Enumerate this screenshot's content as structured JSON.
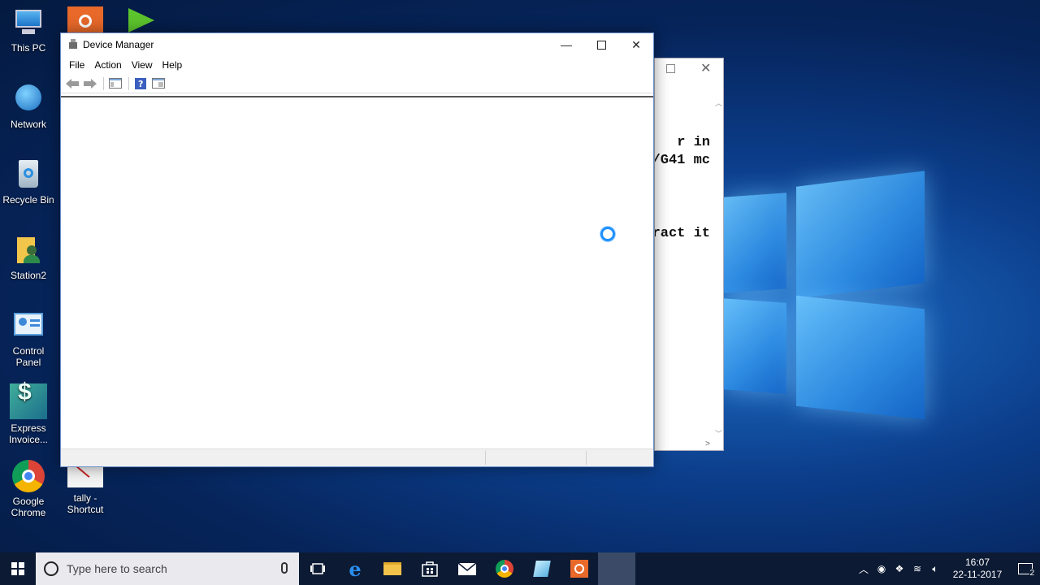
{
  "desktop_icons": [
    {
      "label": "This PC"
    },
    {
      "label": "Network"
    },
    {
      "label": "Recycle Bin"
    },
    {
      "label": "Station2"
    },
    {
      "label": "Control Panel"
    },
    {
      "label": "Express Invoice..."
    },
    {
      "label": "Google Chrome"
    },
    {
      "label": "tally - Shortcut"
    }
  ],
  "background_window": {
    "lines": [
      "r in",
      "/G41 mc",
      "ract it"
    ]
  },
  "device_manager": {
    "title": "Device Manager",
    "menu": [
      "File",
      "Action",
      "View",
      "Help"
    ],
    "toolbar_icons": [
      "back-arrow-icon",
      "forward-arrow-icon",
      "show-hide-console-tree-icon",
      "help-icon",
      "properties-icon"
    ]
  },
  "taskbar": {
    "search_placeholder": "Type here to search",
    "apps": [
      "task-view",
      "edge",
      "file-explorer",
      "store",
      "mail",
      "chrome",
      "notepad",
      "presentation-app",
      "device-manager"
    ]
  },
  "tray": {
    "time": "16:07",
    "date": "22-11-2017",
    "notification_count": "2"
  },
  "colors": {
    "desktop_bg": "#0b3d8a",
    "taskbar_bg": "#0c1a33",
    "spinner": "#1e90ff"
  }
}
